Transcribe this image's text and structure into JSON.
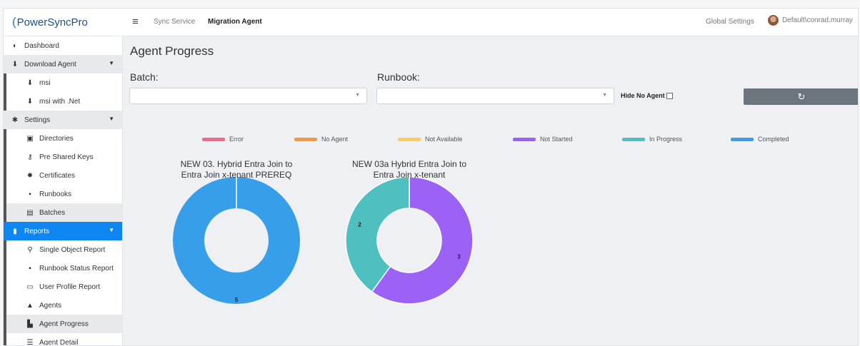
{
  "brand": {
    "logo_c": "(",
    "name": "PowerSyncPro"
  },
  "topbar": {
    "menu_icon": "≡",
    "nav_sync": "Sync Service",
    "nav_migration": "Migration Agent",
    "global_settings": "Global Settings",
    "user": "Default\\conrad.murray"
  },
  "sidebar": {
    "items": [
      {
        "label": "Dashboard",
        "icon": "dashboard-icon",
        "glyph": "◐"
      },
      {
        "label": "Download Agent",
        "icon": "download-icon",
        "glyph": "⬇"
      },
      {
        "label": "msi",
        "icon": "download-icon",
        "glyph": "⬇"
      },
      {
        "label": "msi with .Net",
        "icon": "download-icon",
        "glyph": "⬇"
      },
      {
        "label": "Settings",
        "icon": "gear-icon",
        "glyph": "✱"
      },
      {
        "label": "Directories",
        "icon": "directory-icon",
        "glyph": "▣"
      },
      {
        "label": "Pre Shared Keys",
        "icon": "key-icon",
        "glyph": "⚷"
      },
      {
        "label": "Certificates",
        "icon": "certificate-icon",
        "glyph": "✹"
      },
      {
        "label": "Runbooks",
        "icon": "runbook-icon",
        "glyph": "▪"
      },
      {
        "label": "Batches",
        "icon": "batch-icon",
        "glyph": "▤"
      },
      {
        "label": "Reports",
        "icon": "report-icon",
        "glyph": "▮"
      },
      {
        "label": "Single Object Report",
        "icon": "search-icon",
        "glyph": "⚲"
      },
      {
        "label": "Runbook Status Report",
        "icon": "clipboard-check-icon",
        "glyph": "▪"
      },
      {
        "label": "User Profile Report",
        "icon": "id-card-icon",
        "glyph": "▭"
      },
      {
        "label": "Agents",
        "icon": "agent-icon",
        "glyph": "▲"
      },
      {
        "label": "Agent Progress",
        "icon": "chart-icon",
        "glyph": "▙"
      },
      {
        "label": "Agent Detail",
        "icon": "list-icon",
        "glyph": "☰"
      }
    ],
    "chevron": "▼"
  },
  "main": {
    "title": "Agent Progress",
    "batch_label": "Batch:",
    "runbook_label": "Runbook:",
    "batch_value": "",
    "runbook_value": "",
    "select_caret": "▼",
    "hide_no_agent": "Hide No Agent",
    "refresh_icon": "↻"
  },
  "legend": [
    {
      "label": "Error",
      "color": "#f06b86"
    },
    {
      "label": "No Agent",
      "color": "#f9973d"
    },
    {
      "label": "Not Available",
      "color": "#fdcd5a"
    },
    {
      "label": "Not Started",
      "color": "#9b62f5"
    },
    {
      "label": "In Progress",
      "color": "#4dc0bf"
    },
    {
      "label": "Completed",
      "color": "#379ee9"
    }
  ],
  "chart_data": [
    {
      "type": "pie",
      "title_lines": [
        "NEW 03. Hybrid Entra Join to",
        "Entra Join x-tenant PREREQ"
      ],
      "labels": [
        "Completed"
      ],
      "values": [
        5
      ],
      "colors": [
        "#379ee9"
      ]
    },
    {
      "type": "pie",
      "title_lines": [
        "NEW 03a Hybrid Entra Join to",
        "Entra Join x-tenant"
      ],
      "labels": [
        "Not Started",
        "In Progress"
      ],
      "values": [
        3,
        2
      ],
      "colors": [
        "#9b62f5",
        "#4dc0bf"
      ]
    }
  ]
}
